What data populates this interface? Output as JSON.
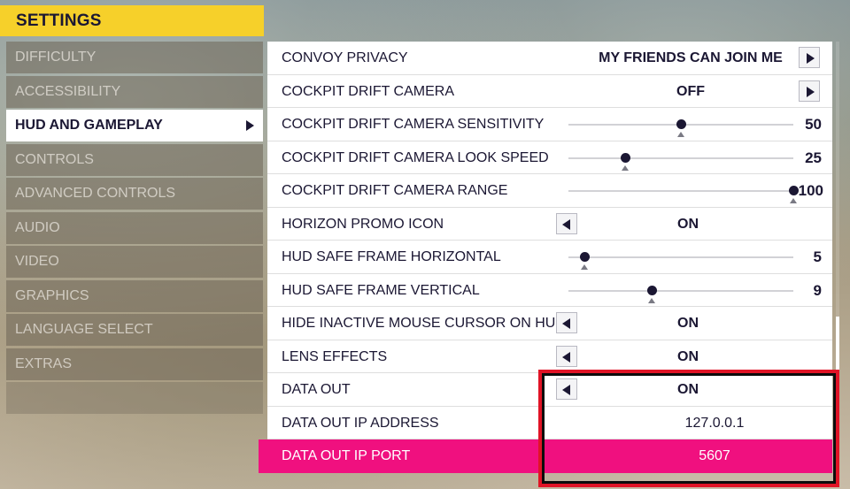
{
  "header": {
    "title": "SETTINGS"
  },
  "sidebar": {
    "items": [
      {
        "label": "DIFFICULTY",
        "active": false
      },
      {
        "label": "ACCESSIBILITY",
        "active": false
      },
      {
        "label": "HUD AND GAMEPLAY",
        "active": true
      },
      {
        "label": "CONTROLS",
        "active": false
      },
      {
        "label": "ADVANCED CONTROLS",
        "active": false
      },
      {
        "label": "AUDIO",
        "active": false
      },
      {
        "label": "VIDEO",
        "active": false
      },
      {
        "label": "GRAPHICS",
        "active": false
      },
      {
        "label": "LANGUAGE SELECT",
        "active": false
      },
      {
        "label": "EXTRAS",
        "active": false
      }
    ]
  },
  "settings": {
    "rows": [
      {
        "label": "CONVOY PRIVACY",
        "type": "right-select",
        "value": "MY FRIENDS CAN JOIN ME"
      },
      {
        "label": "COCKPIT DRIFT CAMERA",
        "type": "right-select",
        "value": "OFF"
      },
      {
        "label": "COCKPIT DRIFT CAMERA SENSITIVITY",
        "type": "slider",
        "value": "50",
        "fraction": 0.5
      },
      {
        "label": "COCKPIT DRIFT CAMERA LOOK SPEED",
        "type": "slider",
        "value": "25",
        "fraction": 0.25
      },
      {
        "label": "COCKPIT DRIFT CAMERA RANGE",
        "type": "slider",
        "value": "100",
        "fraction": 1.0
      },
      {
        "label": "HORIZON PROMO ICON",
        "type": "left-select",
        "value": "ON"
      },
      {
        "label": "HUD SAFE FRAME HORIZONTAL",
        "type": "slider",
        "value": "5",
        "fraction": 0.07
      },
      {
        "label": "HUD SAFE FRAME VERTICAL",
        "type": "slider",
        "value": "9",
        "fraction": 0.37
      },
      {
        "label": "HIDE INACTIVE MOUSE CURSOR ON HUD",
        "type": "left-select",
        "value": "ON"
      },
      {
        "label": "LENS EFFECTS",
        "type": "left-select",
        "value": "ON"
      },
      {
        "label": "DATA OUT",
        "type": "left-select",
        "value": "ON"
      },
      {
        "label": "DATA OUT IP ADDRESS",
        "type": "text",
        "value": "127.0.0.1"
      },
      {
        "label": "DATA OUT IP PORT",
        "type": "text",
        "value": "5607",
        "highlighted": true
      }
    ]
  },
  "colors": {
    "header_yellow": "#f6d02a",
    "highlight_pink": "#f0107f",
    "annotation_red": "#e01426",
    "text_dark": "#1b1733"
  }
}
